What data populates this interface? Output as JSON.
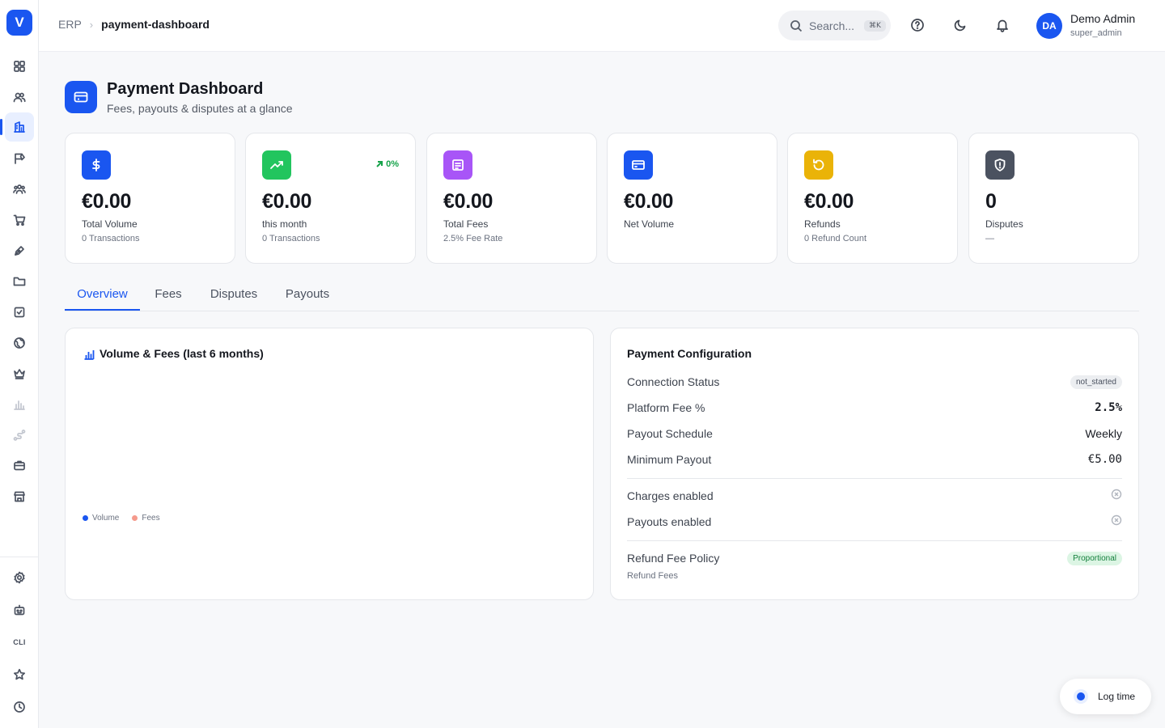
{
  "app": {
    "logo_letter": "V",
    "brand_color": "#1a56f0"
  },
  "sidebar": {
    "items": [
      {
        "icon": "grid-icon"
      },
      {
        "icon": "users-icon"
      },
      {
        "icon": "building-icon",
        "active": true
      },
      {
        "icon": "flag-icon"
      },
      {
        "icon": "team-icon"
      },
      {
        "icon": "cart-icon"
      },
      {
        "icon": "pen-icon"
      },
      {
        "icon": "folder-icon"
      },
      {
        "icon": "checkbox-icon"
      },
      {
        "icon": "globe-icon"
      },
      {
        "icon": "crown-icon"
      },
      {
        "icon": "bar-chart-icon"
      },
      {
        "icon": "route-icon"
      },
      {
        "icon": "briefcase-icon"
      },
      {
        "icon": "store-icon"
      }
    ],
    "bottom_items": [
      {
        "icon": "gear-icon"
      },
      {
        "icon": "robot-icon"
      },
      {
        "label": "CLI"
      },
      {
        "icon": "star-icon"
      },
      {
        "icon": "clock-icon"
      }
    ]
  },
  "topbar": {
    "breadcrumb": {
      "root": "ERP",
      "current": "payment-dashboard"
    },
    "search": {
      "placeholder": "Search...",
      "shortcut": "⌘K"
    },
    "user": {
      "initials": "DA",
      "name": "Demo Admin",
      "role": "super_admin"
    }
  },
  "header": {
    "title": "Payment Dashboard",
    "subtitle": "Fees, payouts & disputes at a glance"
  },
  "stats": [
    {
      "value": "€0.00",
      "label": "Total Volume",
      "sub": "0 Transactions",
      "icon": "dollar-icon",
      "color": "#1a56f0"
    },
    {
      "value": "€0.00",
      "label": "this month",
      "sub": "0 Transactions",
      "icon": "trending-up-icon",
      "color": "#22c55e",
      "trend": "0%"
    },
    {
      "value": "€0.00",
      "label": "Total Fees",
      "sub": "2.5% Fee Rate",
      "icon": "receipt-icon",
      "color": "#a855f7"
    },
    {
      "value": "€0.00",
      "label": "Net Volume",
      "sub": "",
      "icon": "card-icon",
      "color": "#1a56f0"
    },
    {
      "value": "€0.00",
      "label": "Refunds",
      "sub": "0 Refund Count",
      "icon": "refund-icon",
      "color": "#eab308"
    },
    {
      "value": "0",
      "label": "Disputes",
      "sub": "—",
      "icon": "shield-icon",
      "color": "#4b5260"
    }
  ],
  "tabs": [
    {
      "label": "Overview",
      "active": true
    },
    {
      "label": "Fees"
    },
    {
      "label": "Disputes"
    },
    {
      "label": "Payouts"
    }
  ],
  "chart": {
    "title": "Volume & Fees (last 6 months)",
    "legend": [
      {
        "name": "Volume",
        "color": "#1a56f0"
      },
      {
        "name": "Fees",
        "color": "#f59a8c"
      }
    ]
  },
  "chart_data": {
    "type": "bar",
    "title": "Volume & Fees (last 6 months)",
    "categories": [],
    "series": [
      {
        "name": "Volume",
        "values": []
      },
      {
        "name": "Fees",
        "values": []
      }
    ],
    "legend_position": "bottom-left"
  },
  "config": {
    "title": "Payment Configuration",
    "rows": {
      "connection_status": {
        "label": "Connection Status",
        "value": "not_started"
      },
      "platform_fee": {
        "label": "Platform Fee %",
        "value": "2.5%"
      },
      "payout_schedule": {
        "label": "Payout Schedule",
        "value": "Weekly"
      },
      "minimum_payout": {
        "label": "Minimum Payout",
        "value": "€5.00"
      },
      "charges_enabled": {
        "label": "Charges enabled",
        "enabled": false
      },
      "payouts_enabled": {
        "label": "Payouts enabled",
        "enabled": false
      },
      "refund_fee_policy": {
        "label": "Refund Fee Policy",
        "value": "Proportional",
        "note": "Refund Fees"
      }
    }
  },
  "log_time": {
    "label": "Log time"
  }
}
